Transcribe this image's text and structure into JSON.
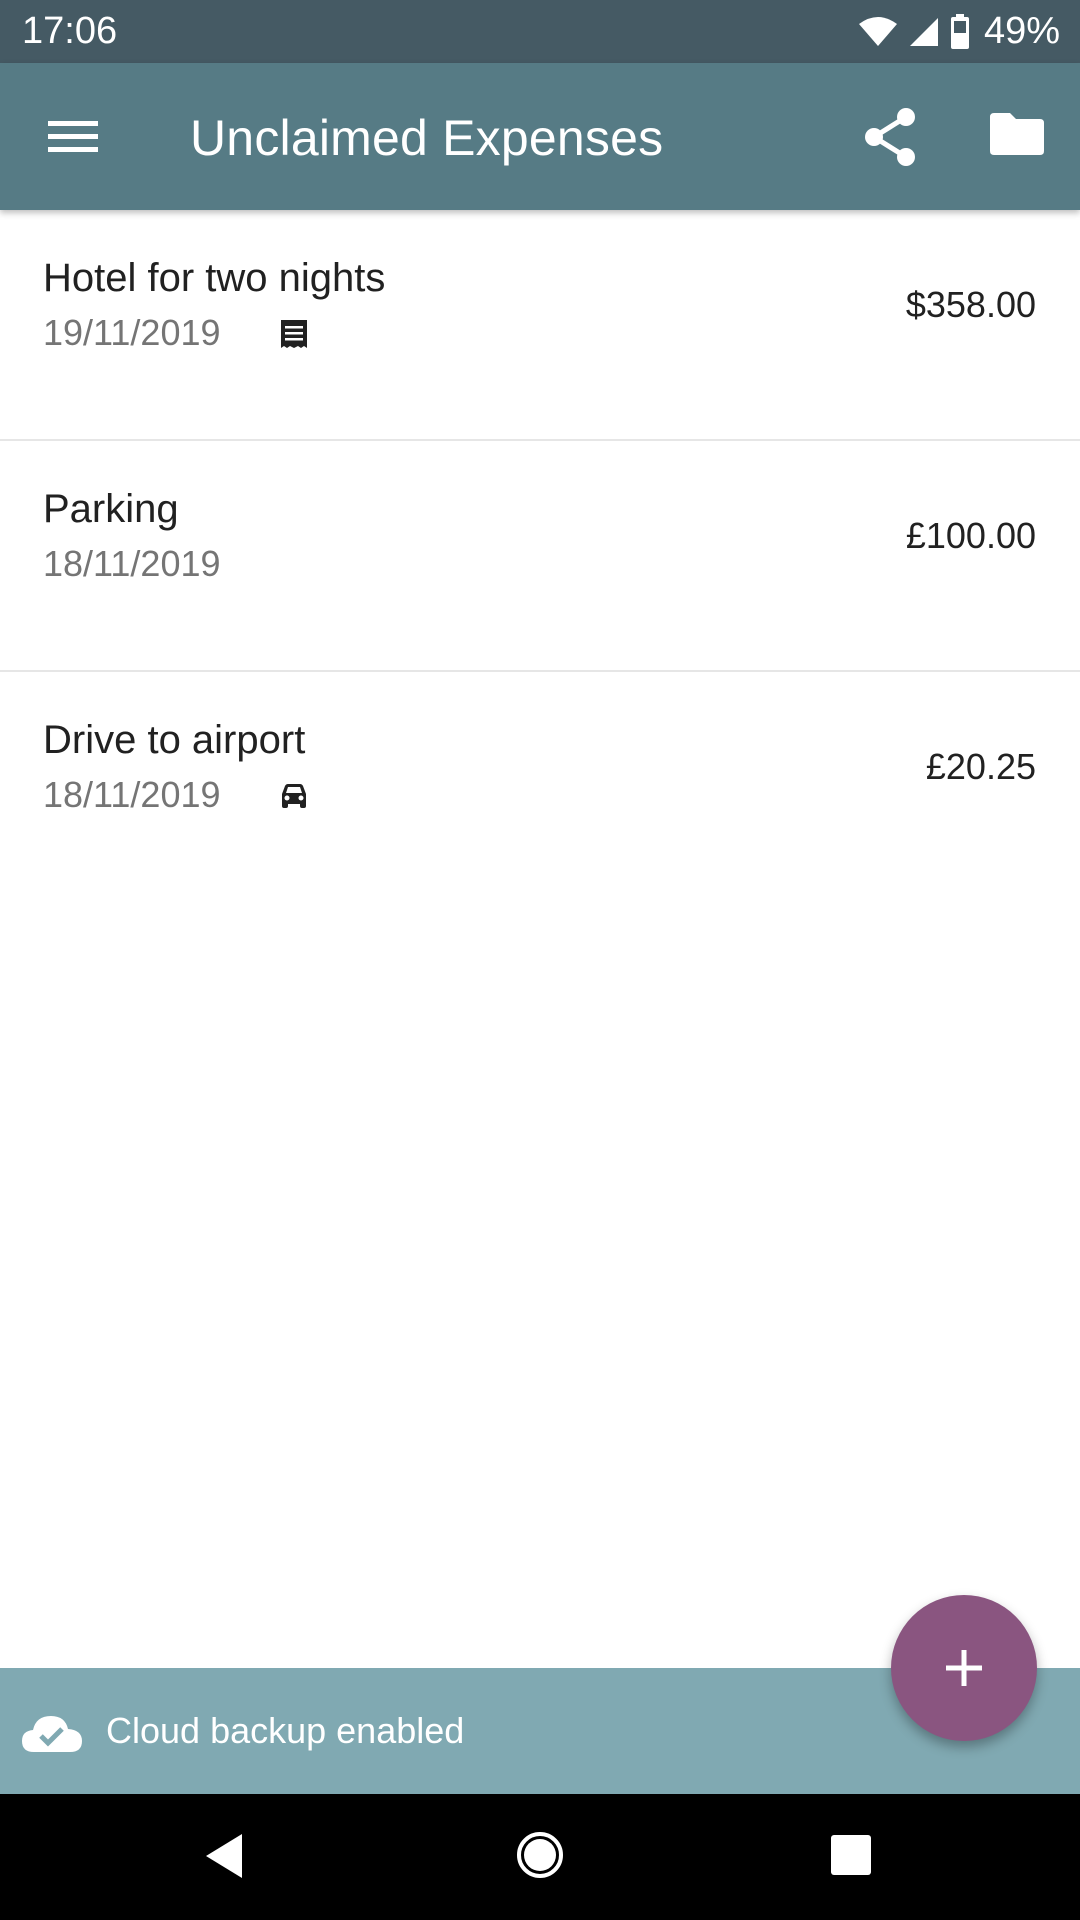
{
  "status_bar": {
    "time": "17:06",
    "battery": "49%",
    "icons": [
      "wifi-icon",
      "signal-icon",
      "battery-icon"
    ]
  },
  "app_bar": {
    "title": "Unclaimed Expenses",
    "menu_icon": "menu-icon",
    "share_icon": "share-icon",
    "folder_icon": "folder-icon",
    "color": "#567b85"
  },
  "expenses": [
    {
      "title": "Hotel for two nights",
      "date": "19/11/2019",
      "amount": "$358.00",
      "icon": "receipt-icon"
    },
    {
      "title": "Parking",
      "date": "18/11/2019",
      "amount": "£100.00",
      "icon": ""
    },
    {
      "title": "Drive to airport",
      "date": "18/11/2019",
      "amount": "£20.25",
      "icon": "car-icon"
    }
  ],
  "snackbar": {
    "text": "Cloud backup enabled",
    "icon": "cloud-done-icon",
    "color": "#80a9b2"
  },
  "fab": {
    "icon": "plus-icon",
    "color": "#8a5580"
  },
  "nav_bar": {
    "icons": [
      "back-icon",
      "home-icon",
      "recents-icon"
    ]
  }
}
